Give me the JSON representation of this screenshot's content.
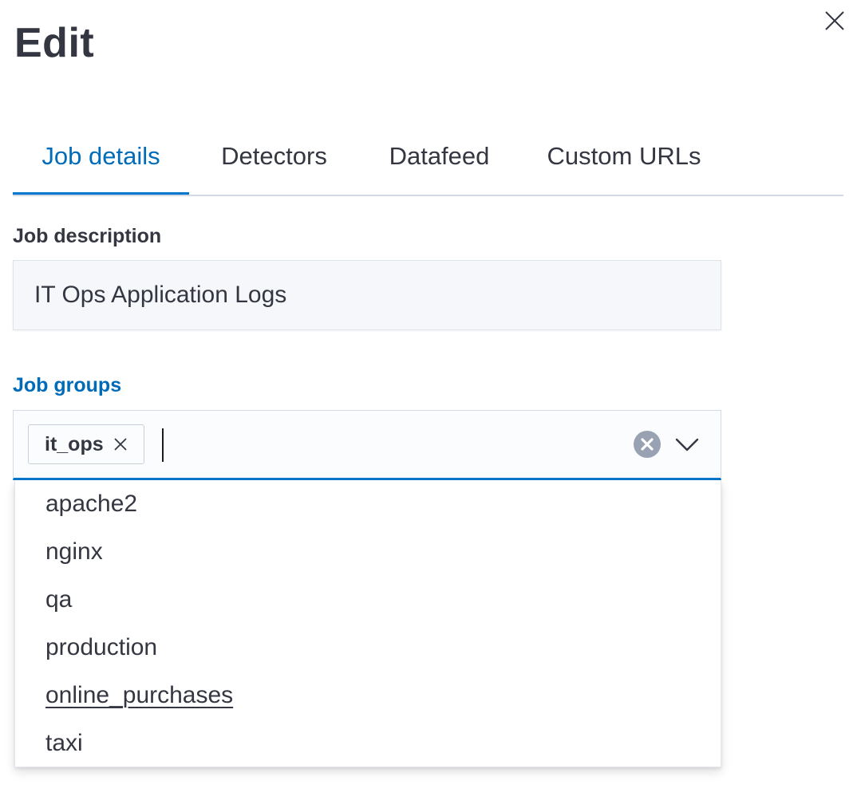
{
  "flyout": {
    "title": "Edit",
    "close_icon": "close-icon"
  },
  "tabs": [
    {
      "label": "Job details",
      "active": true
    },
    {
      "label": "Detectors",
      "active": false
    },
    {
      "label": "Datafeed",
      "active": false
    },
    {
      "label": "Custom URLs",
      "active": false
    }
  ],
  "job_description": {
    "label": "Job description",
    "value": "IT Ops Application Logs"
  },
  "job_groups": {
    "label": "Job groups",
    "selected": [
      {
        "label": "it_ops",
        "remove_icon": "close-icon"
      }
    ],
    "input_value": "",
    "clear_icon": "clear-circle-icon",
    "toggle_icon": "chevron-down-icon",
    "options": [
      "apache2",
      "nginx",
      "qa",
      "production",
      "online_purchases",
      "taxi"
    ],
    "focused_option": "online_purchases"
  },
  "colors": {
    "accent": "#006bb8",
    "tab_underline": "#0077cc",
    "text": "#343741",
    "input_bg": "#f5f7fa"
  }
}
